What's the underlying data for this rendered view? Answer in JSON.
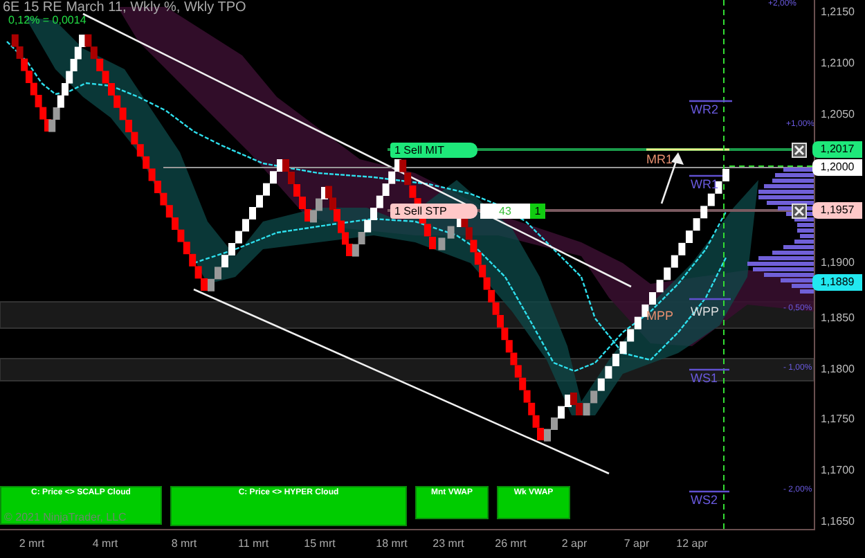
{
  "chart": {
    "title": "6E 15 RE March 11, Wkly %, Wkly TPO",
    "scale_note": "0,12% = 0,0014",
    "price_ticks": [
      "1,2150",
      "1,2100",
      "1,2050",
      "1,1900",
      "1,1850",
      "1,1800",
      "1,1750",
      "1,1700",
      "1,1650"
    ],
    "time_ticks": [
      "2 mrt",
      "4 mrt",
      "8 mrt",
      "11 mrt",
      "15 mrt",
      "18 mrt",
      "23 mrt",
      "26 mrt",
      "2 apr",
      "7 apr",
      "12 apr"
    ],
    "percent_labels": [
      "+2,00%",
      "+1,00%",
      "- 0,50%",
      "- 1,00%",
      "- 2,00%"
    ],
    "pivot_labels": [
      {
        "text": "WR2",
        "kind": "weekly"
      },
      {
        "text": "MR1",
        "kind": "monthly"
      },
      {
        "text": "WR1",
        "kind": "weekly"
      },
      {
        "text": "MPP",
        "kind": "monthly"
      },
      {
        "text": "WPP",
        "kind": "weekly"
      },
      {
        "text": "WS1",
        "kind": "weekly"
      },
      {
        "text": "WS2",
        "kind": "weekly"
      }
    ],
    "price_markers": [
      {
        "text": "1,2017",
        "color": "#1ee87a"
      },
      {
        "text": "1,2000",
        "color": "#ffffff"
      },
      {
        "text": "1,1957",
        "color": "#ffc8c8"
      },
      {
        "text": "1,1889",
        "color": "#22e8f0"
      }
    ],
    "orders": [
      {
        "label": "1 Sell MIT",
        "color": "#1ee87a"
      },
      {
        "label": "1 Sell STP",
        "color": "#ffc8c8",
        "quantity": "43",
        "count": "1"
      }
    ]
  },
  "buttons": [
    "C: Price <> SCALP Cloud",
    "C: Price <> HYPER Cloud",
    "Mnt VWAP",
    "Wk VWAP"
  ],
  "copyright": "© 2021 NinjaTrader, LLC"
}
